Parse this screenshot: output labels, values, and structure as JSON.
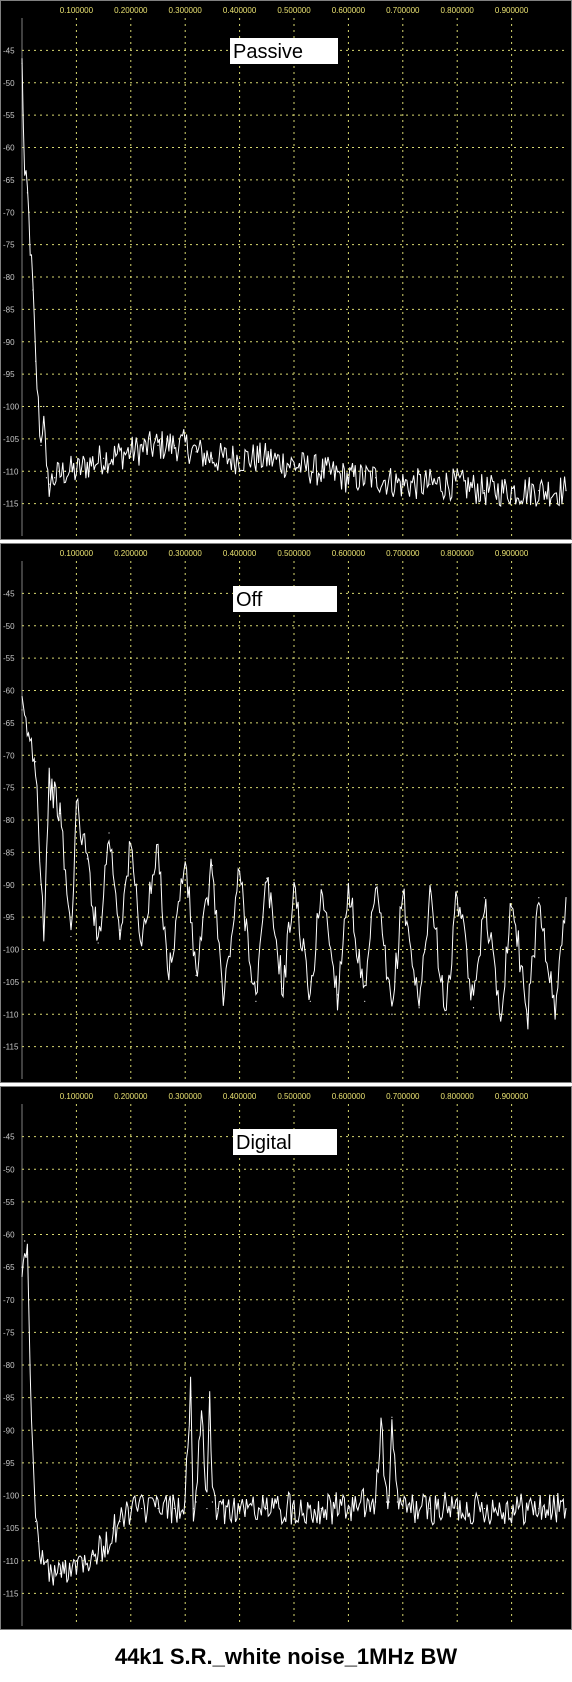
{
  "caption": "44k1 S.R._white noise_1MHz BW",
  "colors": {
    "background": "#000000",
    "grid": "#d8d870",
    "trace": "#ffffff",
    "xtick": "#e8e070",
    "ytick": "#c8c8c8",
    "frame": "#808080"
  },
  "chart_data": [
    {
      "type": "line",
      "title": "Passive",
      "xlim": [
        0,
        1.0
      ],
      "ylim": [
        -120,
        -40
      ],
      "xticks": [
        "0.100000",
        "0.200000",
        "0.300000",
        "0.400000",
        "0.500000",
        "0.600000",
        "0.700000",
        "0.800000",
        "0.900000"
      ],
      "yticks": [
        "-45",
        "-50",
        "-55",
        "-60",
        "-65",
        "-70",
        "-75",
        "-80",
        "-85",
        "-90",
        "-95",
        "-100",
        "-105",
        "-110",
        "-115"
      ],
      "x": [
        0.0,
        0.005,
        0.01,
        0.015,
        0.02,
        0.025,
        0.03,
        0.035,
        0.04,
        0.045,
        0.05,
        0.06,
        0.08,
        0.1,
        0.12,
        0.15,
        0.2,
        0.25,
        0.28,
        0.3,
        0.32,
        0.35,
        0.4,
        0.45,
        0.5,
        0.55,
        0.6,
        0.65,
        0.7,
        0.75,
        0.8,
        0.85,
        0.9,
        0.95,
        1.0
      ],
      "y": [
        -47,
        -65,
        -67,
        -75,
        -82,
        -93,
        -100,
        -106,
        -100,
        -111,
        -112,
        -111,
        -110,
        -110,
        -109,
        -108,
        -107,
        -106,
        -106,
        -106,
        -107,
        -108,
        -108,
        -108,
        -109,
        -110,
        -111,
        -111,
        -112,
        -112,
        -112,
        -113,
        -113,
        -113,
        -113
      ]
    },
    {
      "type": "line",
      "title": "Off",
      "xlim": [
        0,
        1.0
      ],
      "ylim": [
        -120,
        -40
      ],
      "xticks": [
        "0.100000",
        "0.200000",
        "0.300000",
        "0.400000",
        "0.500000",
        "0.600000",
        "0.700000",
        "0.800000",
        "0.900000"
      ],
      "yticks": [
        "-45",
        "-50",
        "-55",
        "-60",
        "-65",
        "-70",
        "-75",
        "-80",
        "-85",
        "-90",
        "-95",
        "-100",
        "-105",
        "-110",
        "-115"
      ],
      "x": [
        0.0,
        0.012,
        0.025,
        0.04,
        0.05,
        0.07,
        0.09,
        0.1,
        0.12,
        0.14,
        0.16,
        0.18,
        0.2,
        0.22,
        0.25,
        0.27,
        0.3,
        0.32,
        0.35,
        0.37,
        0.4,
        0.43,
        0.45,
        0.48,
        0.5,
        0.53,
        0.55,
        0.58,
        0.6,
        0.63,
        0.65,
        0.68,
        0.7,
        0.73,
        0.75,
        0.78,
        0.8,
        0.83,
        0.85,
        0.88,
        0.9,
        0.93,
        0.95,
        0.98,
        1.0
      ],
      "y": [
        -63,
        -67,
        -71,
        -97,
        -74,
        -79,
        -98,
        -78,
        -86,
        -99,
        -82,
        -97,
        -84,
        -99,
        -85,
        -104,
        -86,
        -104,
        -87,
        -108,
        -88,
        -108,
        -89,
        -106,
        -90,
        -108,
        -90,
        -107,
        -90,
        -108,
        -90,
        -110,
        -91,
        -109,
        -91,
        -110,
        -91,
        -109,
        -92,
        -110,
        -92,
        -110,
        -92,
        -110,
        -92
      ]
    },
    {
      "type": "line",
      "title": "Digital",
      "xlim": [
        0,
        1.0
      ],
      "ylim": [
        -120,
        -40
      ],
      "xticks": [
        "0.100000",
        "0.200000",
        "0.300000",
        "0.400000",
        "0.500000",
        "0.600000",
        "0.700000",
        "0.800000",
        "0.900000"
      ],
      "yticks": [
        "-45",
        "-50",
        "-55",
        "-60",
        "-65",
        "-70",
        "-75",
        "-80",
        "-85",
        "-90",
        "-95",
        "-100",
        "-105",
        "-110",
        "-115"
      ],
      "x": [
        0.0,
        0.005,
        0.01,
        0.015,
        0.02,
        0.025,
        0.03,
        0.04,
        0.05,
        0.07,
        0.1,
        0.13,
        0.15,
        0.18,
        0.2,
        0.22,
        0.25,
        0.28,
        0.3,
        0.31,
        0.315,
        0.32,
        0.33,
        0.34,
        0.345,
        0.35,
        0.36,
        0.4,
        0.45,
        0.5,
        0.55,
        0.6,
        0.65,
        0.66,
        0.67,
        0.675,
        0.68,
        0.69,
        0.7,
        0.75,
        0.8,
        0.85,
        0.9,
        0.95,
        1.0
      ],
      "y": [
        -65,
        -61,
        -63,
        -80,
        -95,
        -104,
        -107,
        -110,
        -112,
        -112,
        -110,
        -109,
        -108,
        -104,
        -102,
        -102,
        -102,
        -102,
        -101,
        -84,
        -102,
        -101,
        -85,
        -102,
        -86,
        -101,
        -102,
        -102,
        -102,
        -102,
        -102,
        -102,
        -101,
        -89,
        -101,
        -101,
        -88,
        -101,
        -102,
        -102,
        -102,
        -102,
        -102,
        -102,
        -102
      ]
    }
  ]
}
